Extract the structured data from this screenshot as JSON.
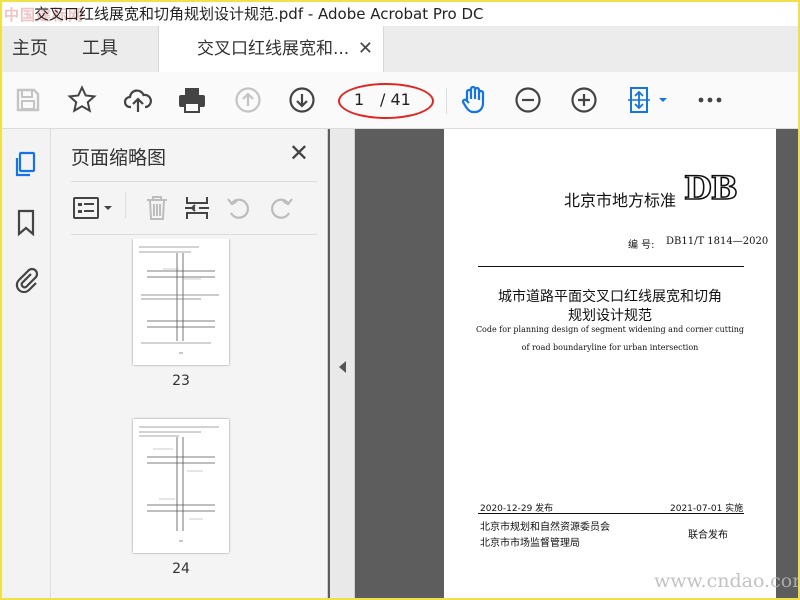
{
  "window": {
    "title": "交叉口红线展宽和切角规划设计规范.pdf - Adobe Acrobat Pro DC",
    "watermark": "中国建标网"
  },
  "tabs": [
    {
      "label": "主页"
    },
    {
      "label": "工具"
    },
    {
      "label": "交叉口红线展宽和..."
    }
  ],
  "toolbar": {
    "page_current": "1",
    "page_total": "/ 41",
    "accent": "#1473e6",
    "icons": [
      "save-icon",
      "bookmark-star-icon",
      "cloud-upload-icon",
      "print-icon",
      "page-up-icon",
      "page-down-icon",
      "hand-tool-icon",
      "zoom-out-icon",
      "zoom-in-icon",
      "fit-page-icon",
      "more-icon"
    ]
  },
  "side_panel": {
    "title": "页面缩略图",
    "thumbnails": [
      {
        "page": "23"
      },
      {
        "page": "24"
      }
    ]
  },
  "document": {
    "standard_label": "北京市地方标准",
    "logo_text": "DB",
    "code_label": "编  号:",
    "code_value": "DB11/T 1814—2020",
    "title_line1": "城市道路平面交叉口红线展宽和切角",
    "title_line2": "规划设计规范",
    "english_line1": "Code for planning design of segment widening and corner cutting",
    "english_line2": "of road boundaryline for urban intersection",
    "issue_date": "2020-12-29 发布",
    "implement_date": "2021-07-01 实施",
    "publisher1": "北京市规划和自然资源委员会",
    "publisher2": "北京市市场监督管理局",
    "joint_release": "联合发布"
  },
  "site_watermark": "www.cndao.com"
}
